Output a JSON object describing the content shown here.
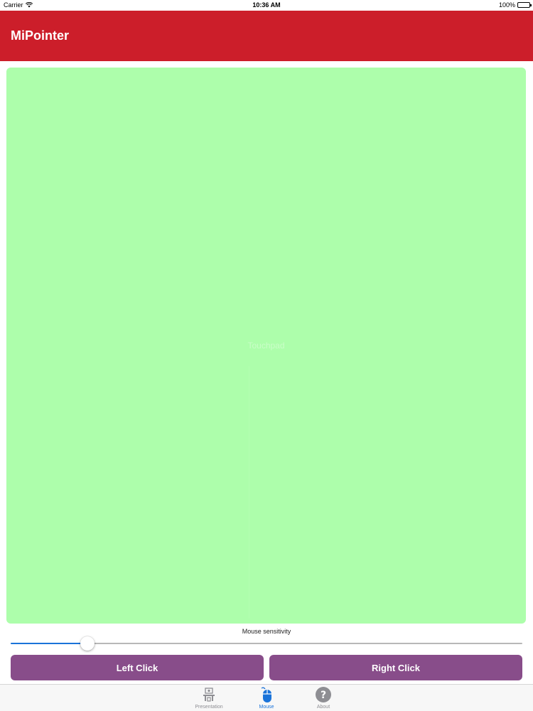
{
  "status_bar": {
    "carrier": "Carrier",
    "time": "10:36 AM",
    "battery": "100%"
  },
  "nav": {
    "title": "MiPointer"
  },
  "touchpad": {
    "hint_text": "Touchpad"
  },
  "sensitivity": {
    "label": "Mouse sensitivity",
    "value": 0.15
  },
  "buttons": {
    "left_click": "Left Click",
    "right_click": "Right Click"
  },
  "tabs": [
    {
      "label": "Presentation",
      "icon": "presentation-icon",
      "active": false
    },
    {
      "label": "Mouse",
      "icon": "mouse-icon",
      "active": true
    },
    {
      "label": "About",
      "icon": "question-icon",
      "active": false
    }
  ],
  "colors": {
    "nav_bar": "#cc1e2a",
    "touchpad": "#adfeab",
    "button": "#884d8a",
    "accent": "#1a73d9"
  }
}
